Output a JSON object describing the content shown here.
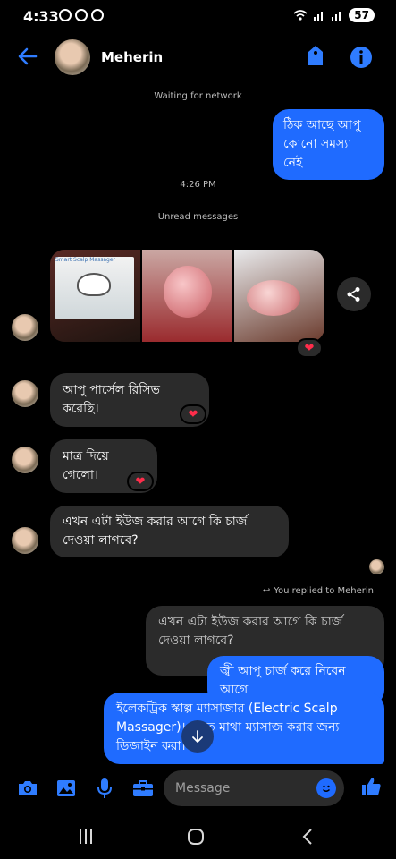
{
  "status": {
    "time": "4:33",
    "battery": "57"
  },
  "header": {
    "name": "Meherin"
  },
  "system": {
    "waiting": "Waiting for network",
    "time_separator": "4:26 PM",
    "unread": "Unread messages"
  },
  "messages": {
    "out1": "ঠিক আছে আপু\nকোনো সমস্যা নেই",
    "in1": "আপু পার্সেল রিসিভ করেছি।",
    "in2": "মাত্র দিয়ে গেলো।",
    "in3": "এখন এটা ইউজ করার আগে কি চার্জ দেওয়া লাগবে?",
    "replied_label": "You replied to Meherin",
    "quoted": "এখন এটা ইউজ করার আগে কি চার্জ দেওয়া লাগবে?",
    "out2": "জ্বী আপু চার্জ করে নিবেন আগে",
    "out3": "ইলেকট্রিক স্কাল্প ম্যাসাজার (Electric Scalp Massager)। মূলত মাথা ম্যাসাজ করার জন্য ডিজাইন করা।"
  },
  "photo_text": {
    "box_label": "Smart Scalp Massager"
  },
  "reactions": {
    "heart": "❤"
  },
  "composer": {
    "placeholder": "Message"
  },
  "colors": {
    "accent": "#1f6bff",
    "incoming_bubble": "#2b2b2b",
    "background": "#000000"
  }
}
